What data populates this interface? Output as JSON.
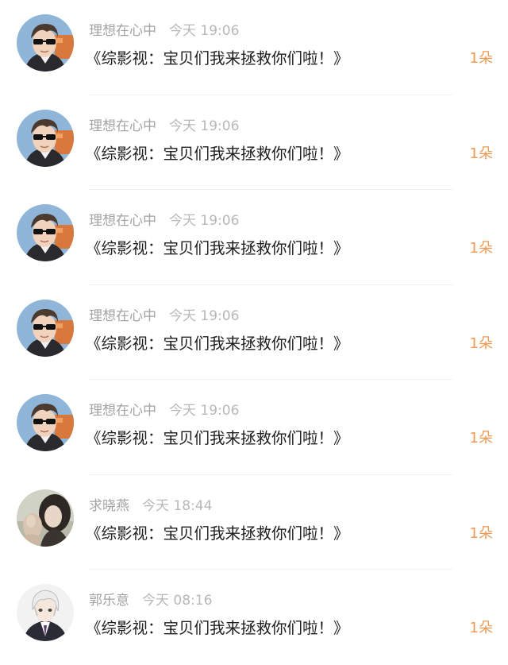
{
  "accent_color": "#ee9a55",
  "items": [
    {
      "username": "理想在心中",
      "time": "今天 19:06",
      "message": "《综影视：宝贝们我来拯救你们啦！》",
      "count": "1朵",
      "avatar": "sunglasses-man-avatar"
    },
    {
      "username": "理想在心中",
      "time": "今天 19:06",
      "message": "《综影视：宝贝们我来拯救你们啦！》",
      "count": "1朵",
      "avatar": "sunglasses-man-avatar"
    },
    {
      "username": "理想在心中",
      "time": "今天 19:06",
      "message": "《综影视：宝贝们我来拯救你们啦！》",
      "count": "1朵",
      "avatar": "sunglasses-man-avatar"
    },
    {
      "username": "理想在心中",
      "time": "今天 19:06",
      "message": "《综影视：宝贝们我来拯救你们啦！》",
      "count": "1朵",
      "avatar": "sunglasses-man-avatar"
    },
    {
      "username": "理想在心中",
      "time": "今天 19:06",
      "message": "《综影视：宝贝们我来拯救你们啦！》",
      "count": "1朵",
      "avatar": "sunglasses-man-avatar"
    },
    {
      "username": "求晓燕",
      "time": "今天 18:44",
      "message": "《综影视：宝贝们我来拯救你们啦！》",
      "count": "1朵",
      "avatar": "girl-photo-avatar"
    },
    {
      "username": "郭乐意",
      "time": "今天 08:16",
      "message": "《综影视：宝贝们我来拯救你们啦！》",
      "count": "1朵",
      "avatar": "anime-boy-avatar"
    }
  ]
}
